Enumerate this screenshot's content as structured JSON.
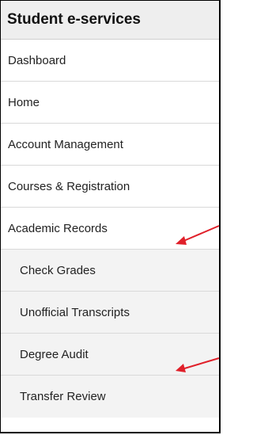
{
  "sidebar": {
    "title": "Student e-services",
    "items": [
      {
        "label": "Dashboard"
      },
      {
        "label": "Home"
      },
      {
        "label": "Account Management"
      },
      {
        "label": "Courses & Registration"
      },
      {
        "label": "Academic Records"
      }
    ],
    "subitems": [
      {
        "label": "Check Grades"
      },
      {
        "label": "Unofficial Transcripts"
      },
      {
        "label": "Degree Audit"
      },
      {
        "label": "Transfer Review"
      }
    ]
  },
  "colors": {
    "annotation_arrow": "#e0202a"
  }
}
